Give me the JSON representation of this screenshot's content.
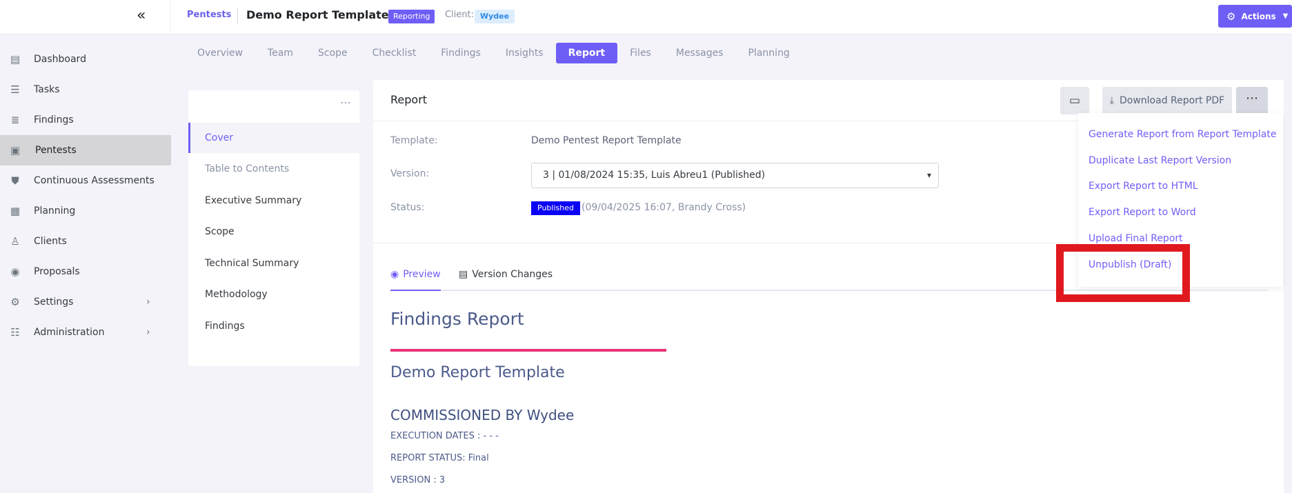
{
  "header": {
    "breadcrumb": "Pentests",
    "title": "Demo Report Template",
    "status_badge": "Reporting",
    "client_label": "Client:",
    "client_name": "Wydee",
    "actions_label": "Actions"
  },
  "sidebar": {
    "items": [
      {
        "label": "Dashboard",
        "icon": "dashboard-icon"
      },
      {
        "label": "Tasks",
        "icon": "tasks-icon"
      },
      {
        "label": "Findings",
        "icon": "findings-icon"
      },
      {
        "label": "Pentests",
        "icon": "pentests-icon"
      },
      {
        "label": "Continuous Assessments",
        "icon": "shield-icon"
      },
      {
        "label": "Planning",
        "icon": "calendar-icon"
      },
      {
        "label": "Clients",
        "icon": "clients-icon"
      },
      {
        "label": "Proposals",
        "icon": "proposals-icon"
      },
      {
        "label": "Settings",
        "icon": "gear-icon"
      },
      {
        "label": "Administration",
        "icon": "sliders-icon"
      }
    ]
  },
  "tabs": [
    "Overview",
    "Team",
    "Scope",
    "Checklist",
    "Findings",
    "Insights",
    "Report",
    "Files",
    "Messages",
    "Planning"
  ],
  "sections": [
    "Cover",
    "Table to Contents",
    "Executive Summary",
    "Scope",
    "Technical Summary",
    "Methodology",
    "Findings"
  ],
  "report": {
    "title": "Report",
    "download_label": "Download Report PDF",
    "template_label": "Template:",
    "template_value": "Demo Pentest Report Template",
    "version_label": "Version:",
    "version_value": "3 | 01/08/2024 15:35, Luis Abreu1 (Published)",
    "status_label": "Status:",
    "status_badge": "Published",
    "status_meta": "(09/04/2025 16:07, Brandy Cross)",
    "preview_tab": "Preview",
    "version_changes_tab": "Version Changes"
  },
  "preview": {
    "title": "Findings Report",
    "subtitle": "Demo Report Template",
    "commissioned": "COMMISSIONED BY Wydee",
    "execution_dates": "EXECUTION DATES : - - -",
    "report_status": "REPORT STATUS: Final",
    "version": "VERSION : 3"
  },
  "dropdown": {
    "items": [
      "Generate Report from Report Template",
      "Duplicate Last Report Version",
      "Export Report to HTML",
      "Export Report to Word",
      "Upload Final Report",
      "Unpublish (Draft)"
    ]
  },
  "colors": {
    "accent": "#6f5ef6",
    "published": "#0a00f5",
    "highlight": "#e0191f",
    "divider_pink": "#e8337b"
  }
}
